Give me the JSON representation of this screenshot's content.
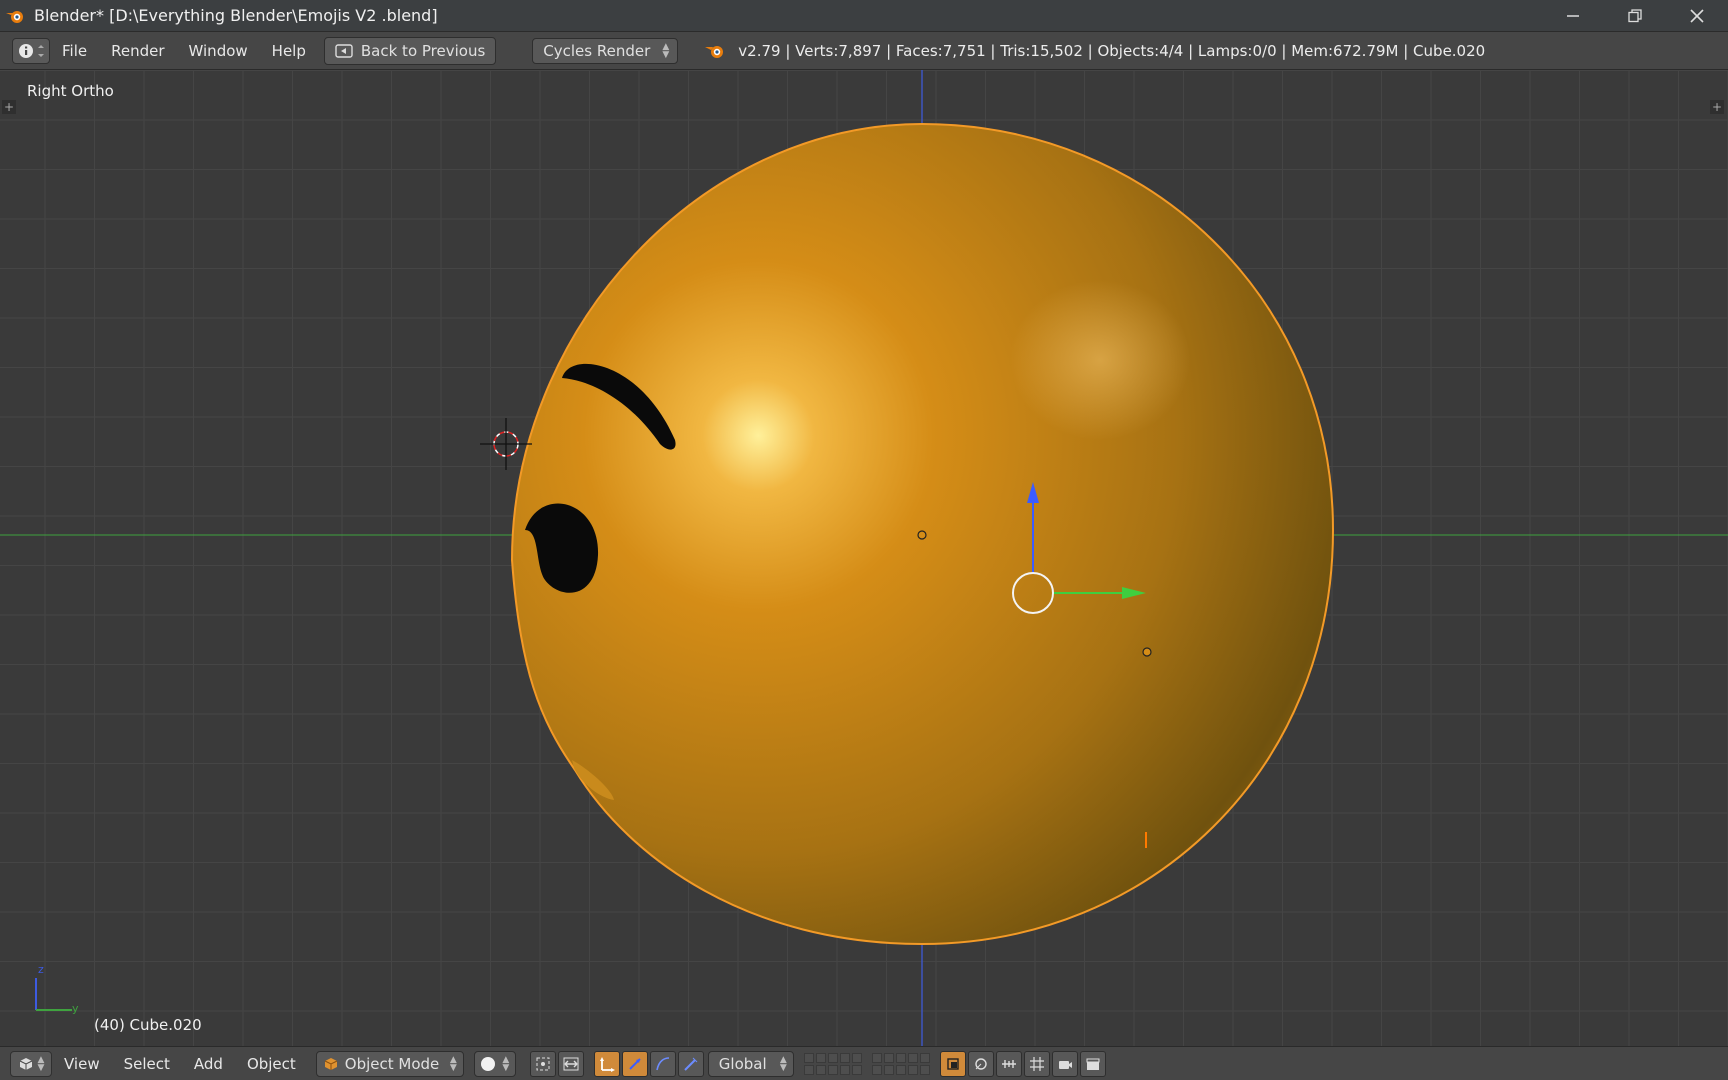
{
  "window": {
    "title": "Blender* [D:\\Everything Blender\\Emojis V2 .blend]",
    "controls": [
      "minimize-icon",
      "restore-icon",
      "close-icon"
    ]
  },
  "info_header": {
    "menus": [
      "File",
      "Render",
      "Window",
      "Help"
    ],
    "back_label": "Back to Previous",
    "render_engine": "Cycles Render",
    "stats": "v2.79 | Verts:7,897 | Faces:7,751 | Tris:15,502 | Objects:4/4 | Lamps:0/0 | Mem:672.79M | Cube.020"
  },
  "viewport": {
    "view_label": "Right Ortho",
    "object_label": "(40) Cube.020",
    "axis_labels": {
      "z": "z",
      "y": "y"
    },
    "colors": {
      "background": "#3a3a3a",
      "grid": "#454545",
      "z_axis": "#3d5be0",
      "y_axis": "#3fa33f",
      "object": "#d7901a",
      "selection_outline": "#f39a27"
    }
  },
  "footer": {
    "menus": [
      "View",
      "Select",
      "Add",
      "Object"
    ],
    "mode": "Object Mode",
    "orientation": "Global",
    "accent": "#d08a3a"
  }
}
